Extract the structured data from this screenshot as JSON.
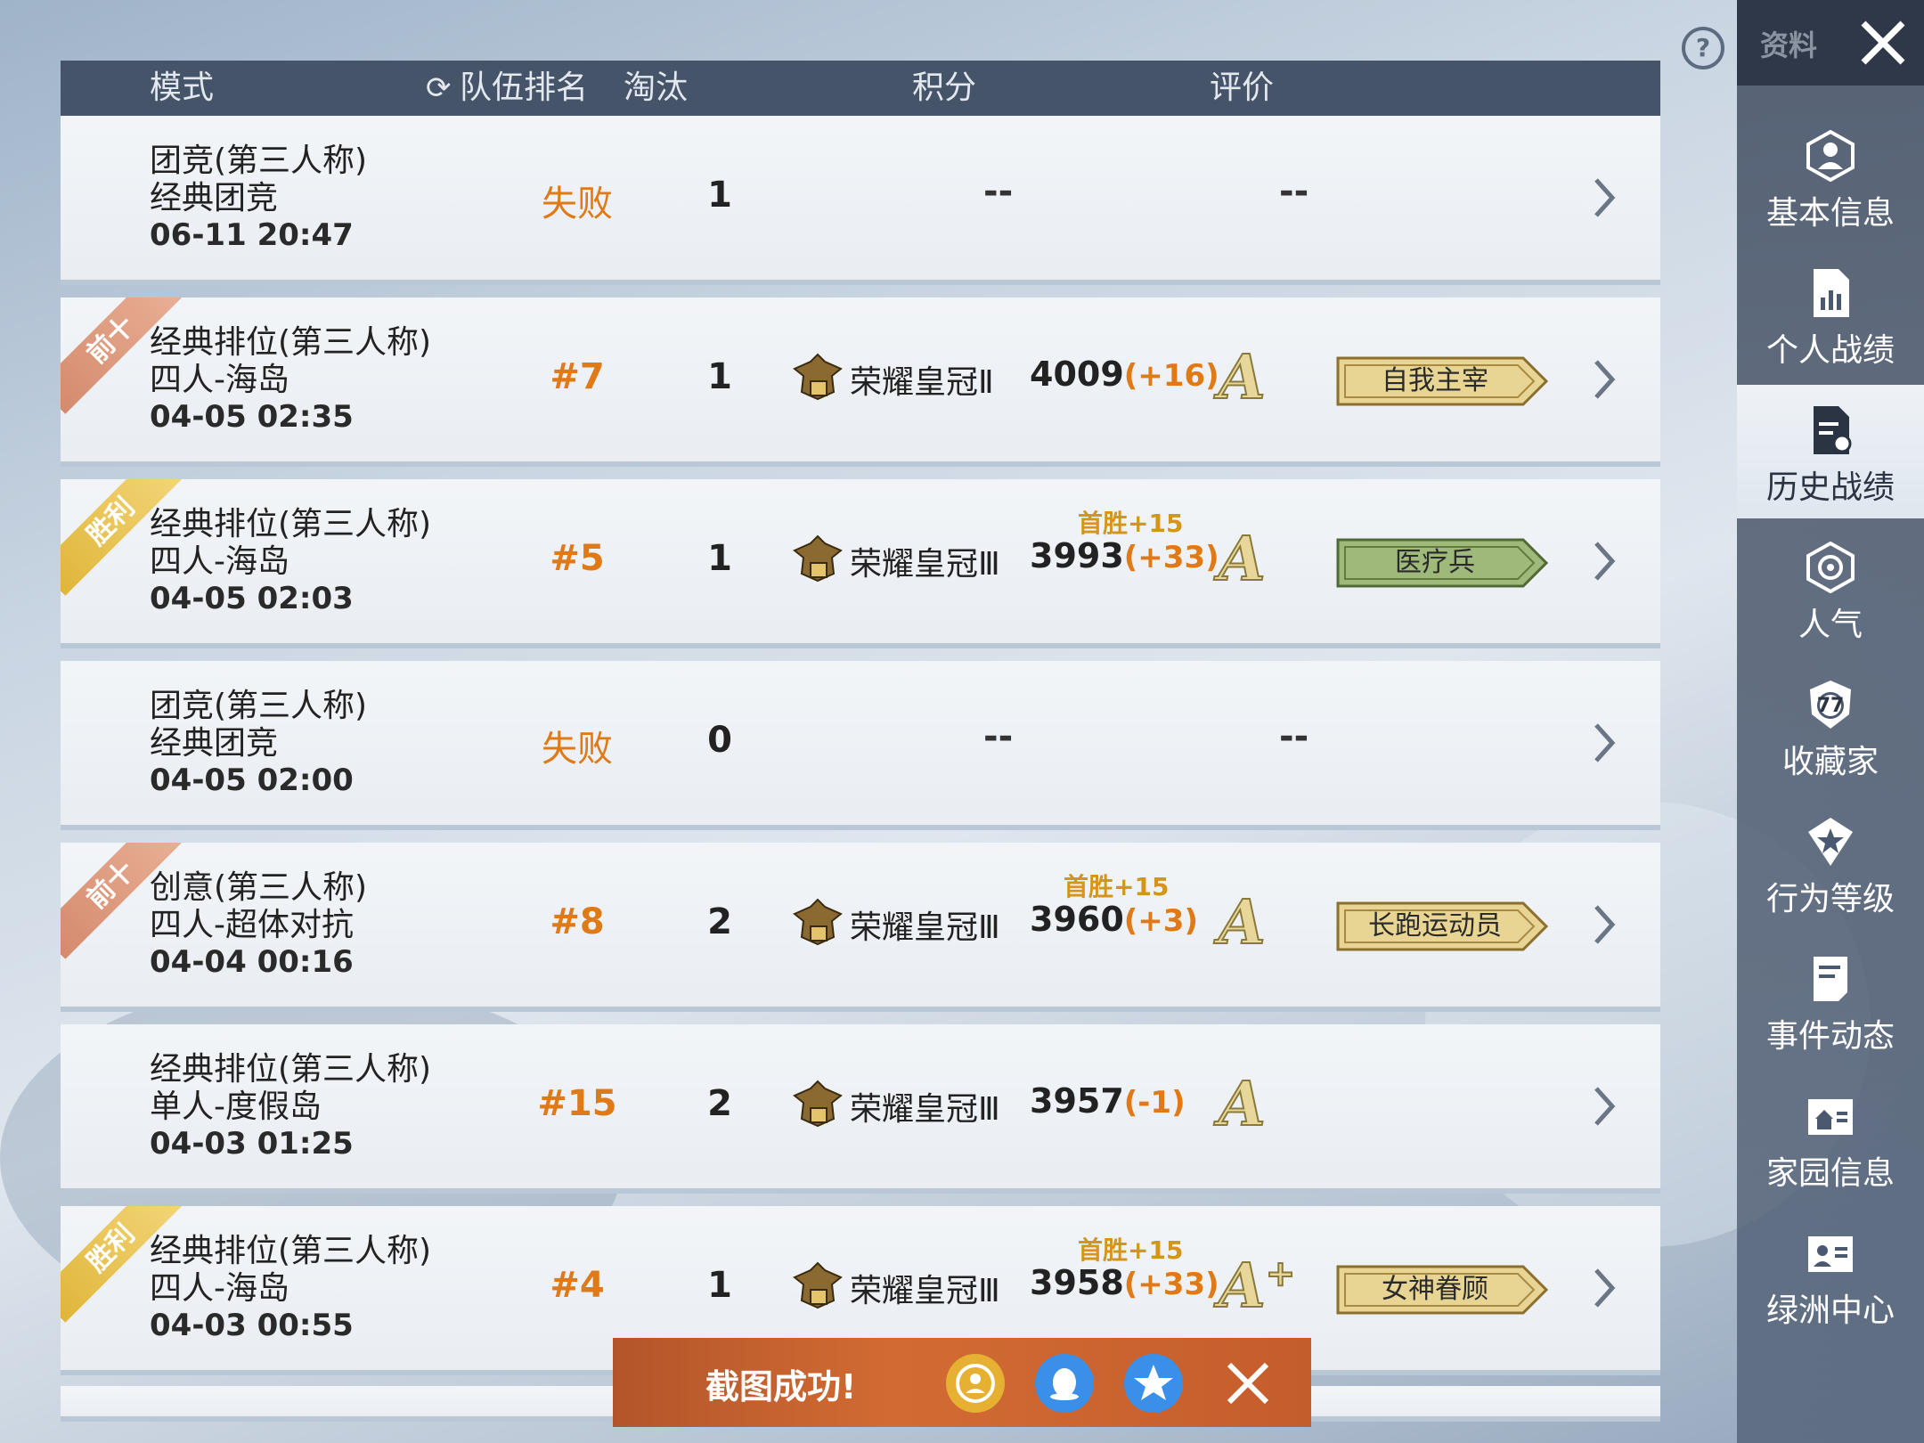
{
  "header": {
    "mode": "模式",
    "team_rank": "队伍排名",
    "eliminations": "淘汰",
    "score": "积分",
    "rating": "评价"
  },
  "rows": [
    {
      "ribbon": "",
      "mode_line1": "团竞(第三人称)",
      "mode_line2": "经典团竞",
      "date": "06-11 20:47",
      "rank": "失败",
      "elims": "1",
      "score_dash": "--",
      "rating_dash": "--"
    },
    {
      "ribbon": "前十",
      "mode_line1": "经典排位(第三人称)",
      "mode_line2": "四人-海岛",
      "date": "04-05 02:35",
      "rank": "#7",
      "elims": "1",
      "bonus": "",
      "tier": "荣耀皇冠Ⅱ",
      "score": "4009",
      "delta": "(+16)",
      "grade": "A",
      "badge": "自我主宰",
      "badge_color": "#e8d594"
    },
    {
      "ribbon": "胜利",
      "mode_line1": "经典排位(第三人称)",
      "mode_line2": "四人-海岛",
      "date": "04-05 02:03",
      "rank": "#5",
      "elims": "1",
      "bonus": "首胜+15",
      "tier": "荣耀皇冠Ⅲ",
      "score": "3993",
      "delta": "(+33)",
      "grade": "A",
      "badge": "医疗兵",
      "badge_color": "#9fb97a"
    },
    {
      "ribbon": "",
      "mode_line1": "团竞(第三人称)",
      "mode_line2": "经典团竞",
      "date": "04-05 02:00",
      "rank": "失败",
      "elims": "0",
      "score_dash": "--",
      "rating_dash": "--"
    },
    {
      "ribbon": "前十",
      "mode_line1": "创意(第三人称)",
      "mode_line2": "四人-超体对抗",
      "date": "04-04 00:16",
      "rank": "#8",
      "elims": "2",
      "bonus": "首胜+15",
      "tier": "荣耀皇冠Ⅲ",
      "score": "3960",
      "delta": "(+3)",
      "grade": "A",
      "badge": "长跑运动员",
      "badge_color": "#e8d594"
    },
    {
      "ribbon": "",
      "mode_line1": "经典排位(第三人称)",
      "mode_line2": "单人-度假岛",
      "date": "04-03 01:25",
      "rank": "#15",
      "elims": "2",
      "bonus": "",
      "tier": "荣耀皇冠Ⅲ",
      "score": "3957",
      "delta": "(-1)",
      "grade": "A"
    },
    {
      "ribbon": "胜利",
      "mode_line1": "经典排位(第三人称)",
      "mode_line2": "四人-海岛",
      "date": "04-03 00:55",
      "rank": "#4",
      "elims": "1",
      "bonus": "首胜+15",
      "tier": "荣耀皇冠Ⅲ",
      "score": "3958",
      "delta": "(+33)",
      "grade": "A",
      "grade_plus": "+",
      "badge": "女神眷顾",
      "badge_color": "#e8d594"
    }
  ],
  "sidebar": {
    "top_label": "资料",
    "items": [
      {
        "label": "基本信息",
        "icon": "profile-icon"
      },
      {
        "label": "个人战绩",
        "icon": "chart-doc-icon"
      },
      {
        "label": "历史战绩",
        "icon": "history-doc-icon"
      },
      {
        "label": "人气",
        "icon": "popularity-icon"
      },
      {
        "label": "收藏家",
        "icon": "collector-icon",
        "icon_text": "77"
      },
      {
        "label": "行为等级",
        "icon": "behavior-icon"
      },
      {
        "label": "事件动态",
        "icon": "event-icon"
      },
      {
        "label": "家园信息",
        "icon": "home-icon"
      },
      {
        "label": "绿洲中心",
        "icon": "oasis-icon"
      }
    ]
  },
  "toast": {
    "message": "截图成功!"
  },
  "colors": {
    "accent_orange": "#e07a16",
    "header_bg": "#46546a",
    "sidebar_active": "#eef2f7"
  }
}
